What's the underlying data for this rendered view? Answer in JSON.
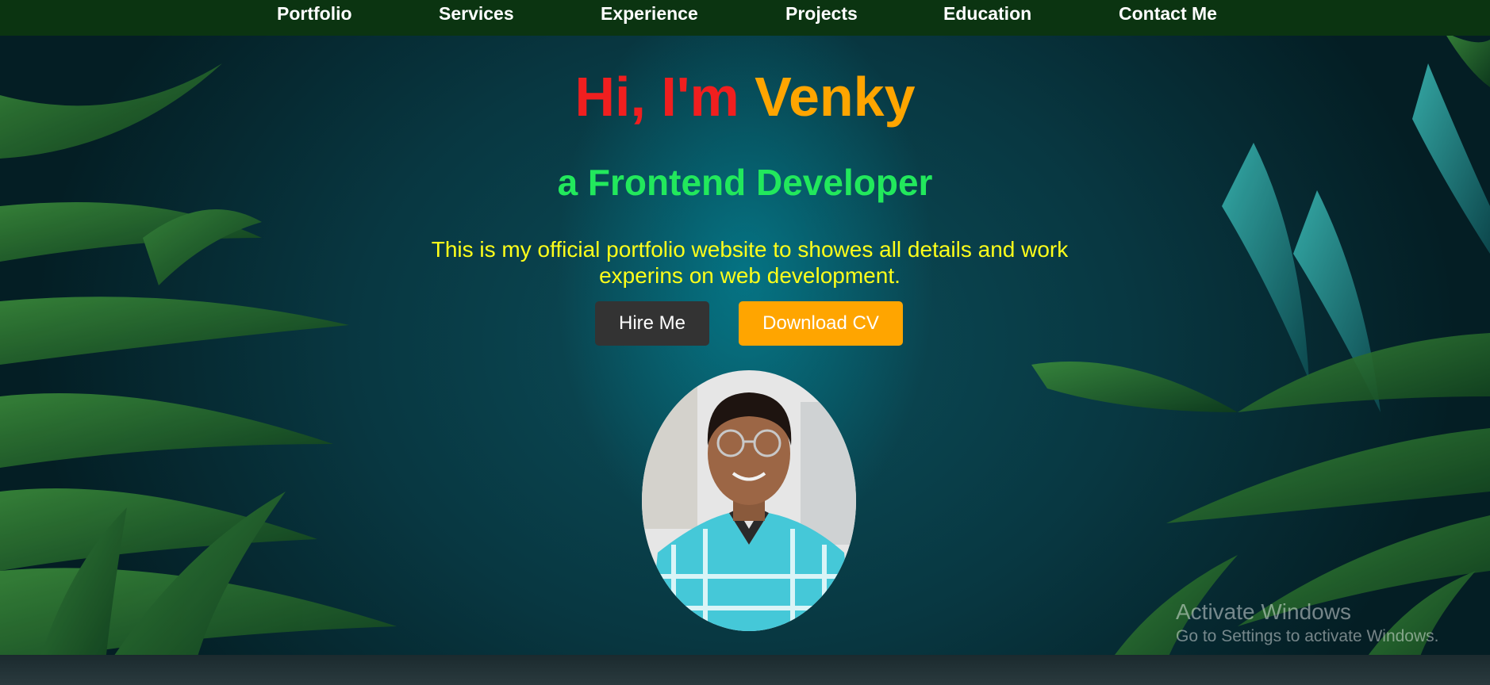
{
  "nav": {
    "items": [
      "Portfolio",
      "Services",
      "Experience",
      "Projects",
      "Education",
      "Contact Me"
    ]
  },
  "hero": {
    "greeting": "Hi, I'm ",
    "name": "Venky",
    "role": "a Frontend Developer",
    "description": "This is my official portfolio website to showes all details and work experins on web development.",
    "hire_label": "Hire Me",
    "cv_label": "Download CV"
  },
  "watermark": {
    "title": "Activate Windows",
    "subtitle": "Go to Settings to activate Windows."
  },
  "colors": {
    "nav_bg": "#0b3411",
    "greeting": "#f01f1f",
    "name": "#ffa500",
    "role": "#22e85c",
    "description": "#ffff1a",
    "hire_button": "#333333",
    "cv_button": "#ffa500"
  }
}
